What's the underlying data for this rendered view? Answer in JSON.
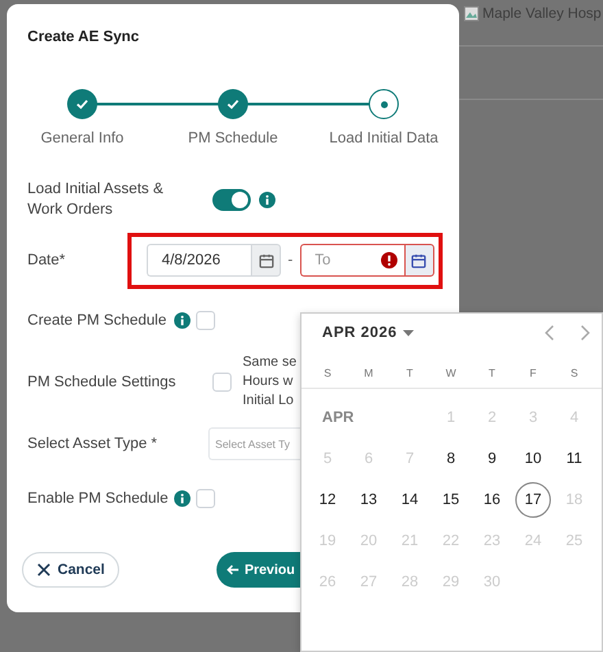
{
  "background": {
    "image_alt": "Maple Valley Hosp"
  },
  "dialog": {
    "title": "Create AE Sync",
    "steps": [
      {
        "label": "General Info",
        "completed": true
      },
      {
        "label": "PM Schedule",
        "completed": true
      },
      {
        "label": "Load Initial Data",
        "completed": false
      }
    ],
    "fields": [
      {
        "kind": "toggle",
        "label": "Load Initial Assets & Work Orders",
        "on": true,
        "info": true
      },
      {
        "kind": "daterange",
        "label": "Date*",
        "from": "4/8/2026",
        "separator": "-",
        "to_placeholder": "To",
        "to_error": true,
        "highlighted": true
      },
      {
        "kind": "checkbox",
        "label": "Create PM Schedule",
        "checked": false,
        "info": true
      },
      {
        "kind": "checkbox",
        "label": "PM Schedule Settings",
        "checked": false,
        "info": false,
        "text": [
          "Same se",
          "Hours w",
          "Initial Lo"
        ]
      },
      {
        "kind": "select",
        "label": "Select Asset Type *",
        "placeholder": "Select Asset Ty"
      },
      {
        "kind": "checkbox",
        "label": "Enable PM Schedule",
        "checked": false,
        "info": true
      }
    ],
    "buttons": [
      {
        "kind": "cancel",
        "label": "Cancel"
      },
      {
        "kind": "previous",
        "label": "Previou"
      }
    ]
  },
  "calendar": {
    "month": "APR 2026",
    "row_label": "APR",
    "weekdays": [
      "S",
      "M",
      "T",
      "W",
      "T",
      "F",
      "S"
    ],
    "days": [
      {
        "label": "1",
        "enabled": false,
        "today": false
      },
      {
        "label": "2",
        "enabled": false,
        "today": false
      },
      {
        "label": "3",
        "enabled": false,
        "today": false
      },
      {
        "label": "4",
        "enabled": false,
        "today": false
      },
      {
        "label": "5",
        "enabled": false,
        "today": false
      },
      {
        "label": "6",
        "enabled": false,
        "today": false
      },
      {
        "label": "7",
        "enabled": false,
        "today": false
      },
      {
        "label": "8",
        "enabled": true,
        "today": false
      },
      {
        "label": "9",
        "enabled": true,
        "today": false
      },
      {
        "label": "10",
        "enabled": true,
        "today": false
      },
      {
        "label": "11",
        "enabled": true,
        "today": false
      },
      {
        "label": "12",
        "enabled": true,
        "today": false
      },
      {
        "label": "13",
        "enabled": true,
        "today": false
      },
      {
        "label": "14",
        "enabled": true,
        "today": false
      },
      {
        "label": "15",
        "enabled": true,
        "today": false
      },
      {
        "label": "16",
        "enabled": true,
        "today": false
      },
      {
        "label": "17",
        "enabled": true,
        "today": true
      },
      {
        "label": "18",
        "enabled": false,
        "today": false
      },
      {
        "label": "19",
        "enabled": false,
        "today": false
      },
      {
        "label": "20",
        "enabled": false,
        "today": false
      },
      {
        "label": "21",
        "enabled": false,
        "today": false
      },
      {
        "label": "22",
        "enabled": false,
        "today": false
      },
      {
        "label": "23",
        "enabled": false,
        "today": false
      },
      {
        "label": "24",
        "enabled": false,
        "today": false
      },
      {
        "label": "25",
        "enabled": false,
        "today": false
      },
      {
        "label": "26",
        "enabled": false,
        "today": false
      },
      {
        "label": "27",
        "enabled": false,
        "today": false
      },
      {
        "label": "28",
        "enabled": false,
        "today": false
      },
      {
        "label": "29",
        "enabled": false,
        "today": false
      },
      {
        "label": "30",
        "enabled": false,
        "today": false
      }
    ]
  }
}
